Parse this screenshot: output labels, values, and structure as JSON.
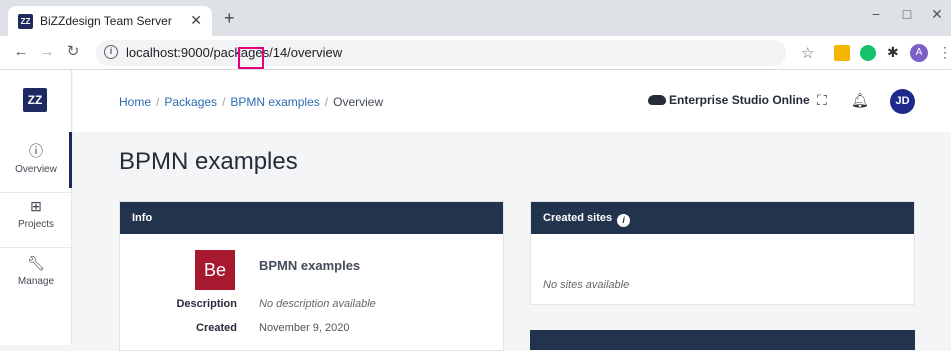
{
  "browser": {
    "tab_title": "BiZZdesign Team Server",
    "tab_favicon": "ZZ",
    "url": "localhost:9000/packages/14/overview",
    "win_controls": {
      "minimize": "−",
      "maximize": "□",
      "close": "✕"
    }
  },
  "nav": {
    "logo": "ZZ",
    "items": [
      {
        "label": "Overview",
        "icon": "info-icon"
      },
      {
        "label": "Projects",
        "icon": "briefcase-icon"
      },
      {
        "label": "Manage",
        "icon": "wrench-icon"
      }
    ]
  },
  "header": {
    "breadcrumb": [
      "Home",
      "Packages",
      "BPMN examples",
      "Overview"
    ],
    "studio_label": "Enterprise Studio Online",
    "avatar": "JD"
  },
  "page": {
    "title": "BPMN examples"
  },
  "info_card": {
    "heading": "Info",
    "icon_text": "Be",
    "name": "BPMN examples",
    "fields": [
      {
        "label": "Description",
        "value": "No description available"
      },
      {
        "label": "Created",
        "value": "November 9, 2020"
      }
    ]
  },
  "sites_card": {
    "heading": "Created sites",
    "empty_text": "No sites available"
  },
  "colors": {
    "brand": "#1d2a62",
    "card_header": "#22344d",
    "be_tile": "#a6192e",
    "link": "#2b6cb0"
  }
}
